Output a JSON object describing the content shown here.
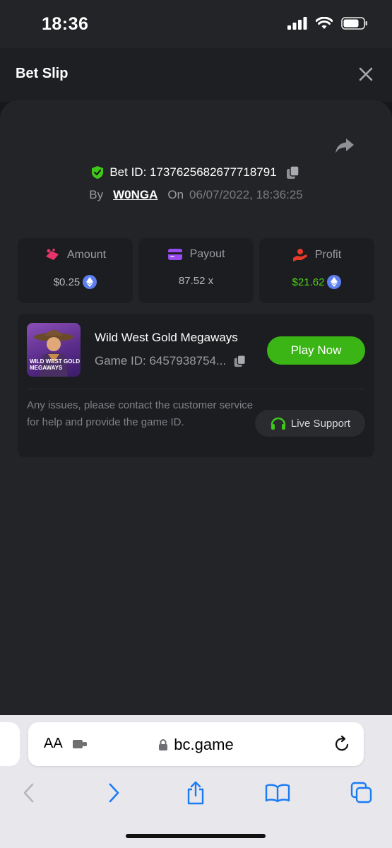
{
  "status_bar": {
    "time": "18:36"
  },
  "header": {
    "title": "Bet Slip"
  },
  "bet": {
    "id_label": "Bet ID: 1737625682677718791",
    "by_label": "By",
    "user": "W0NGA",
    "on_label": "On",
    "date": "06/07/2022, 18:36:25"
  },
  "stats": {
    "amount": {
      "label": "Amount",
      "value": "$0.25"
    },
    "payout": {
      "label": "Payout",
      "value": "87.52 x"
    },
    "profit": {
      "label": "Profit",
      "value": "$21.62"
    }
  },
  "game": {
    "thumb_text_1": "WILD WEST GOLD",
    "thumb_text_2": "MEGAWAYS",
    "name": "Wild West Gold Megaways",
    "id_label": "Game ID: 6457938754...",
    "play_label": "Play Now",
    "issues_text": "Any issues, please contact the customer service for help and provide the game ID.",
    "support_label": "Live Support"
  },
  "browser": {
    "aa_label": "AA",
    "url": "bc.game"
  },
  "colors": {
    "accent_green": "#3bb516",
    "profit_green": "#4cd118",
    "eth_blue": "#5e7ff0",
    "ios_blue": "#1a7cf5"
  }
}
